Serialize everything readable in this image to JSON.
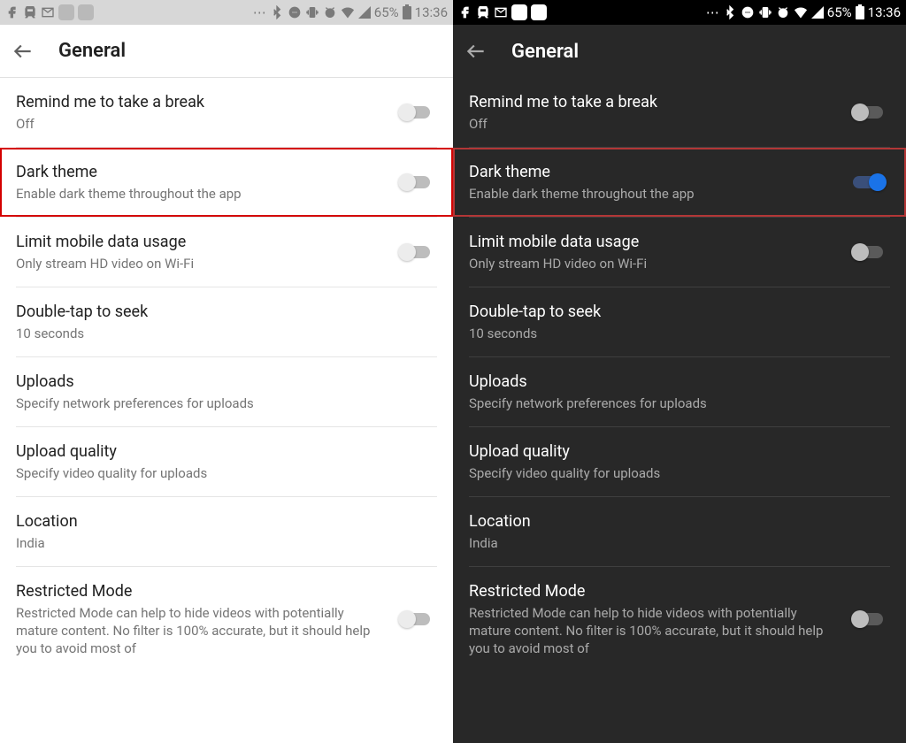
{
  "status": {
    "battery": "65%",
    "time": "13:36"
  },
  "header": {
    "title": "General"
  },
  "rows": {
    "break": {
      "title": "Remind me to take a break",
      "sub": "Off"
    },
    "dark": {
      "title": "Dark theme",
      "sub": "Enable dark theme throughout the app"
    },
    "data": {
      "title": "Limit mobile data usage",
      "sub": "Only stream HD video on Wi-Fi"
    },
    "seek": {
      "title": "Double-tap to seek",
      "sub": "10 seconds"
    },
    "uploads": {
      "title": "Uploads",
      "sub": "Specify network preferences for uploads"
    },
    "uq": {
      "title": "Upload quality",
      "sub": "Specify video quality for uploads"
    },
    "loc": {
      "title": "Location",
      "sub": "India"
    },
    "rm": {
      "title": "Restricted Mode",
      "sub": "Restricted Mode can help to hide videos with potentially mature content. No filter is 100% accurate, but it should help you to avoid most of"
    }
  }
}
